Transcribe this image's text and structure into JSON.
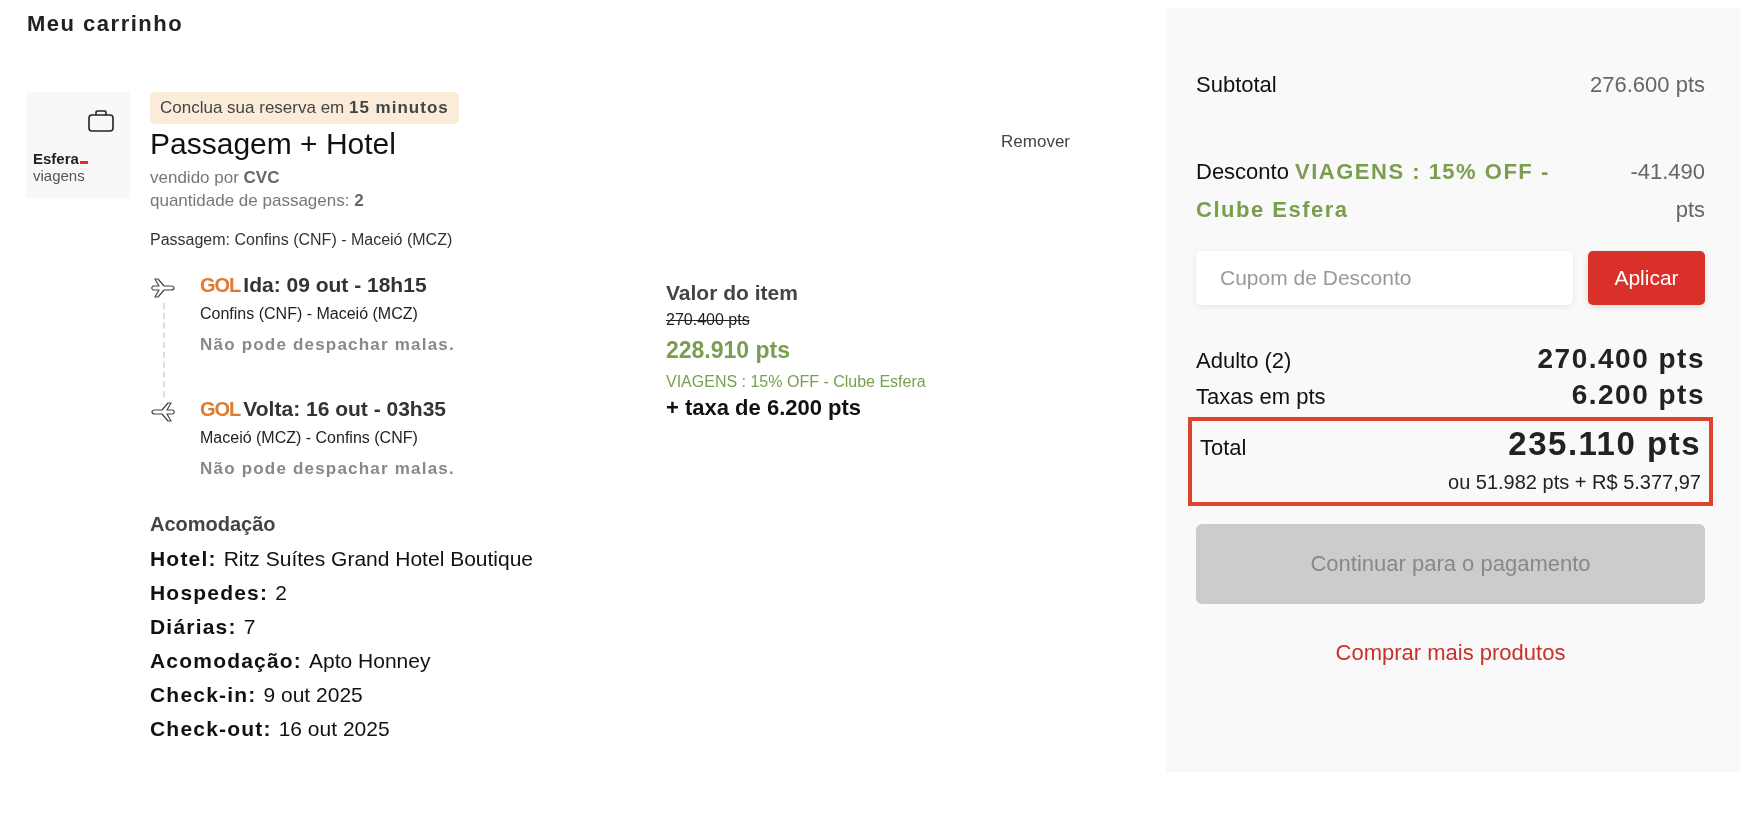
{
  "page_title": "Meu carrinho",
  "cart_item": {
    "logo": {
      "brand": "Esfera",
      "sub": "viagens"
    },
    "timer": "Conclua sua reserva em **15 minutos**",
    "title": "Passagem + Hotel",
    "seller": "vendido por **CVC**",
    "quantity": "quantidade de passagens: **2**",
    "route": "Passagem: Confins (CNF) - Maceió (MCZ)",
    "remove": "Remover",
    "flights": [
      {
        "kind": "outbound",
        "airline": "GOL",
        "title": "Ida: 09 out - 18h15",
        "route": "Confins (CNF) - Maceió (MCZ)",
        "baggage": "Não pode despachar malas."
      },
      {
        "kind": "return",
        "airline": "GOL",
        "title": "Volta: 16 out - 03h35",
        "route": "Maceió (MCZ) - Confins (CNF)",
        "baggage": "Não pode despachar malas."
      }
    ],
    "price": {
      "label": "Valor do item",
      "original": "270.400 pts",
      "current": "228.910 pts",
      "promo": "VIAGENS : 15% OFF - Clube Esfera",
      "fee": "+ taxa de 6.200 pts"
    },
    "accommodation": {
      "heading": "Acomodação",
      "details": [
        {
          "label": "Hotel:",
          "value": "Ritz Suítes Grand Hotel Boutique"
        },
        {
          "label": "Hospedes:",
          "value": "2"
        },
        {
          "label": "Diárias:",
          "value": "7"
        },
        {
          "label": "Acomodação:",
          "value": "Apto Honney"
        },
        {
          "label": "Check-in:",
          "value": "9 out 2025"
        },
        {
          "label": "Check-out:",
          "value": "16 out 2025"
        }
      ]
    }
  },
  "summary": {
    "subtotal": {
      "label": "Subtotal",
      "value": "276.600 pts"
    },
    "discount": {
      "text": "Desconto **VIAGENS : 15% OFF - Clube Esfera**",
      "value": "-41.490 pts"
    },
    "coupon": {
      "placeholder": "Cupom de Desconto",
      "button": "Aplicar"
    },
    "lines": [
      {
        "label": "Adulto (2)",
        "value": "270.400 pts"
      },
      {
        "label": "Taxas em pts",
        "value": "6.200 pts"
      }
    ],
    "total": {
      "label": "Total",
      "value": "235.110 pts",
      "alternative": "ou 51.982 pts + R$ 5.377,97",
      "highlighted": true
    },
    "continue": {
      "label": "Continuar para o pagamento",
      "disabled": true
    },
    "more_link": "Comprar mais produtos"
  }
}
